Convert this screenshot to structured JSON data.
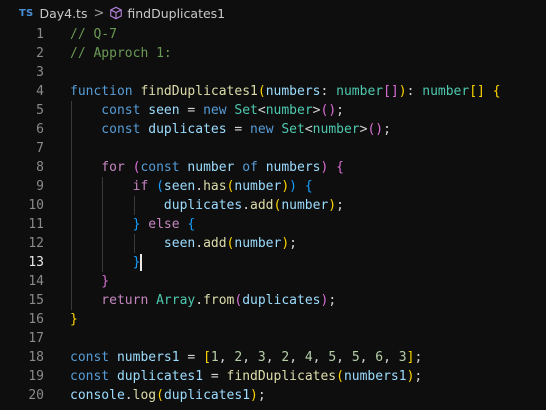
{
  "breadcrumb": {
    "badge": "TS",
    "file": "Day4.ts",
    "separator": ">",
    "symbol": "findDuplicates1",
    "symbol_icon": "cube-icon"
  },
  "editor": {
    "active_line": 13,
    "lines": [
      {
        "n": "1",
        "tokens": [
          {
            "t": "// Q-7",
            "c": "comment"
          }
        ]
      },
      {
        "n": "2",
        "tokens": [
          {
            "t": "// Approch 1:",
            "c": "comment"
          }
        ]
      },
      {
        "n": "3",
        "tokens": []
      },
      {
        "n": "4",
        "tokens": [
          {
            "t": "function ",
            "c": "storage"
          },
          {
            "t": "findDuplicates1",
            "c": "function"
          },
          {
            "t": "(",
            "c": "bracket1"
          },
          {
            "t": "numbers",
            "c": "variable"
          },
          {
            "t": ": ",
            "c": "punct"
          },
          {
            "t": "number",
            "c": "type"
          },
          {
            "t": "[]",
            "c": "bracket2"
          },
          {
            "t": ")",
            "c": "bracket1"
          },
          {
            "t": ": ",
            "c": "punct"
          },
          {
            "t": "number",
            "c": "type"
          },
          {
            "t": "[] ",
            "c": "bracket1"
          },
          {
            "t": "{",
            "c": "bracket1"
          }
        ]
      },
      {
        "n": "5",
        "tokens": [
          {
            "t": "    const ",
            "c": "storage"
          },
          {
            "t": "seen",
            "c": "variable"
          },
          {
            "t": " = ",
            "c": "punct"
          },
          {
            "t": "new ",
            "c": "storage"
          },
          {
            "t": "Set",
            "c": "type"
          },
          {
            "t": "<",
            "c": "punct"
          },
          {
            "t": "number",
            "c": "type"
          },
          {
            "t": ">",
            "c": "punct"
          },
          {
            "t": "()",
            "c": "bracket2"
          },
          {
            "t": ";",
            "c": "punct"
          }
        ]
      },
      {
        "n": "6",
        "tokens": [
          {
            "t": "    const ",
            "c": "storage"
          },
          {
            "t": "duplicates",
            "c": "variable"
          },
          {
            "t": " = ",
            "c": "punct"
          },
          {
            "t": "new ",
            "c": "storage"
          },
          {
            "t": "Set",
            "c": "type"
          },
          {
            "t": "<",
            "c": "punct"
          },
          {
            "t": "number",
            "c": "type"
          },
          {
            "t": ">",
            "c": "punct"
          },
          {
            "t": "()",
            "c": "bracket2"
          },
          {
            "t": ";",
            "c": "punct"
          }
        ]
      },
      {
        "n": "7",
        "tokens": []
      },
      {
        "n": "8",
        "tokens": [
          {
            "t": "    for ",
            "c": "keyword"
          },
          {
            "t": "(",
            "c": "bracket2"
          },
          {
            "t": "const ",
            "c": "storage"
          },
          {
            "t": "number ",
            "c": "variable"
          },
          {
            "t": "of ",
            "c": "storage"
          },
          {
            "t": "numbers",
            "c": "variable"
          },
          {
            "t": ") ",
            "c": "bracket2"
          },
          {
            "t": "{",
            "c": "bracket2"
          }
        ]
      },
      {
        "n": "9",
        "tokens": [
          {
            "t": "        if ",
            "c": "keyword"
          },
          {
            "t": "(",
            "c": "bracket3"
          },
          {
            "t": "seen",
            "c": "variable"
          },
          {
            "t": ".",
            "c": "punct"
          },
          {
            "t": "has",
            "c": "function"
          },
          {
            "t": "(",
            "c": "bracket1"
          },
          {
            "t": "number",
            "c": "variable"
          },
          {
            "t": ")",
            "c": "bracket1"
          },
          {
            "t": ") ",
            "c": "bracket3"
          },
          {
            "t": "{",
            "c": "bracket3"
          }
        ]
      },
      {
        "n": "10",
        "tokens": [
          {
            "t": "            duplicates",
            "c": "variable"
          },
          {
            "t": ".",
            "c": "punct"
          },
          {
            "t": "add",
            "c": "function"
          },
          {
            "t": "(",
            "c": "bracket1"
          },
          {
            "t": "number",
            "c": "variable"
          },
          {
            "t": ")",
            "c": "bracket1"
          },
          {
            "t": ";",
            "c": "punct"
          }
        ]
      },
      {
        "n": "11",
        "tokens": [
          {
            "t": "        } ",
            "c": "bracket3"
          },
          {
            "t": "else ",
            "c": "keyword"
          },
          {
            "t": "{",
            "c": "bracket3"
          }
        ]
      },
      {
        "n": "12",
        "tokens": [
          {
            "t": "            seen",
            "c": "variable"
          },
          {
            "t": ".",
            "c": "punct"
          },
          {
            "t": "add",
            "c": "function"
          },
          {
            "t": "(",
            "c": "bracket1"
          },
          {
            "t": "number",
            "c": "variable"
          },
          {
            "t": ")",
            "c": "bracket1"
          },
          {
            "t": ";",
            "c": "punct"
          }
        ]
      },
      {
        "n": "13",
        "tokens": [
          {
            "t": "        }",
            "c": "bracket3"
          }
        ]
      },
      {
        "n": "14",
        "tokens": [
          {
            "t": "    }",
            "c": "bracket2"
          }
        ]
      },
      {
        "n": "15",
        "tokens": [
          {
            "t": "    return ",
            "c": "keyword"
          },
          {
            "t": "Array",
            "c": "type"
          },
          {
            "t": ".",
            "c": "punct"
          },
          {
            "t": "from",
            "c": "function"
          },
          {
            "t": "(",
            "c": "bracket2"
          },
          {
            "t": "duplicates",
            "c": "variable"
          },
          {
            "t": ")",
            "c": "bracket2"
          },
          {
            "t": ";",
            "c": "punct"
          }
        ]
      },
      {
        "n": "16",
        "tokens": [
          {
            "t": "}",
            "c": "bracket1"
          }
        ]
      },
      {
        "n": "17",
        "tokens": []
      },
      {
        "n": "18",
        "tokens": [
          {
            "t": "const ",
            "c": "storage"
          },
          {
            "t": "numbers1",
            "c": "variable"
          },
          {
            "t": " = ",
            "c": "punct"
          },
          {
            "t": "[",
            "c": "bracket1"
          },
          {
            "t": "1",
            "c": "number"
          },
          {
            "t": ", ",
            "c": "punct"
          },
          {
            "t": "2",
            "c": "number"
          },
          {
            "t": ", ",
            "c": "punct"
          },
          {
            "t": "3",
            "c": "number"
          },
          {
            "t": ", ",
            "c": "punct"
          },
          {
            "t": "2",
            "c": "number"
          },
          {
            "t": ", ",
            "c": "punct"
          },
          {
            "t": "4",
            "c": "number"
          },
          {
            "t": ", ",
            "c": "punct"
          },
          {
            "t": "5",
            "c": "number"
          },
          {
            "t": ", ",
            "c": "punct"
          },
          {
            "t": "5",
            "c": "number"
          },
          {
            "t": ", ",
            "c": "punct"
          },
          {
            "t": "6",
            "c": "number"
          },
          {
            "t": ", ",
            "c": "punct"
          },
          {
            "t": "3",
            "c": "number"
          },
          {
            "t": "]",
            "c": "bracket1"
          },
          {
            "t": ";",
            "c": "punct"
          }
        ]
      },
      {
        "n": "19",
        "tokens": [
          {
            "t": "const ",
            "c": "storage"
          },
          {
            "t": "duplicates1",
            "c": "variable"
          },
          {
            "t": " = ",
            "c": "punct"
          },
          {
            "t": "findDuplicates",
            "c": "function"
          },
          {
            "t": "(",
            "c": "bracket1"
          },
          {
            "t": "numbers1",
            "c": "variable"
          },
          {
            "t": ")",
            "c": "bracket1"
          },
          {
            "t": ";",
            "c": "punct"
          }
        ]
      },
      {
        "n": "20",
        "tokens": [
          {
            "t": "console",
            "c": "variable"
          },
          {
            "t": ".",
            "c": "punct"
          },
          {
            "t": "log",
            "c": "function"
          },
          {
            "t": "(",
            "c": "bracket1"
          },
          {
            "t": "duplicates1",
            "c": "variable"
          },
          {
            "t": ")",
            "c": "bracket1"
          },
          {
            "t": ";",
            "c": "punct"
          }
        ]
      }
    ]
  },
  "colors": {
    "background": "#0e0e0e",
    "comment": "#6a9955",
    "keyword": "#c586c0",
    "storage": "#569cd6",
    "function": "#dcdcaa",
    "variable": "#9cdcfe",
    "type": "#4ec9b0",
    "number": "#b5cea8",
    "bracket1": "#ffd700",
    "bracket2": "#da70d6",
    "bracket3": "#179fff"
  }
}
